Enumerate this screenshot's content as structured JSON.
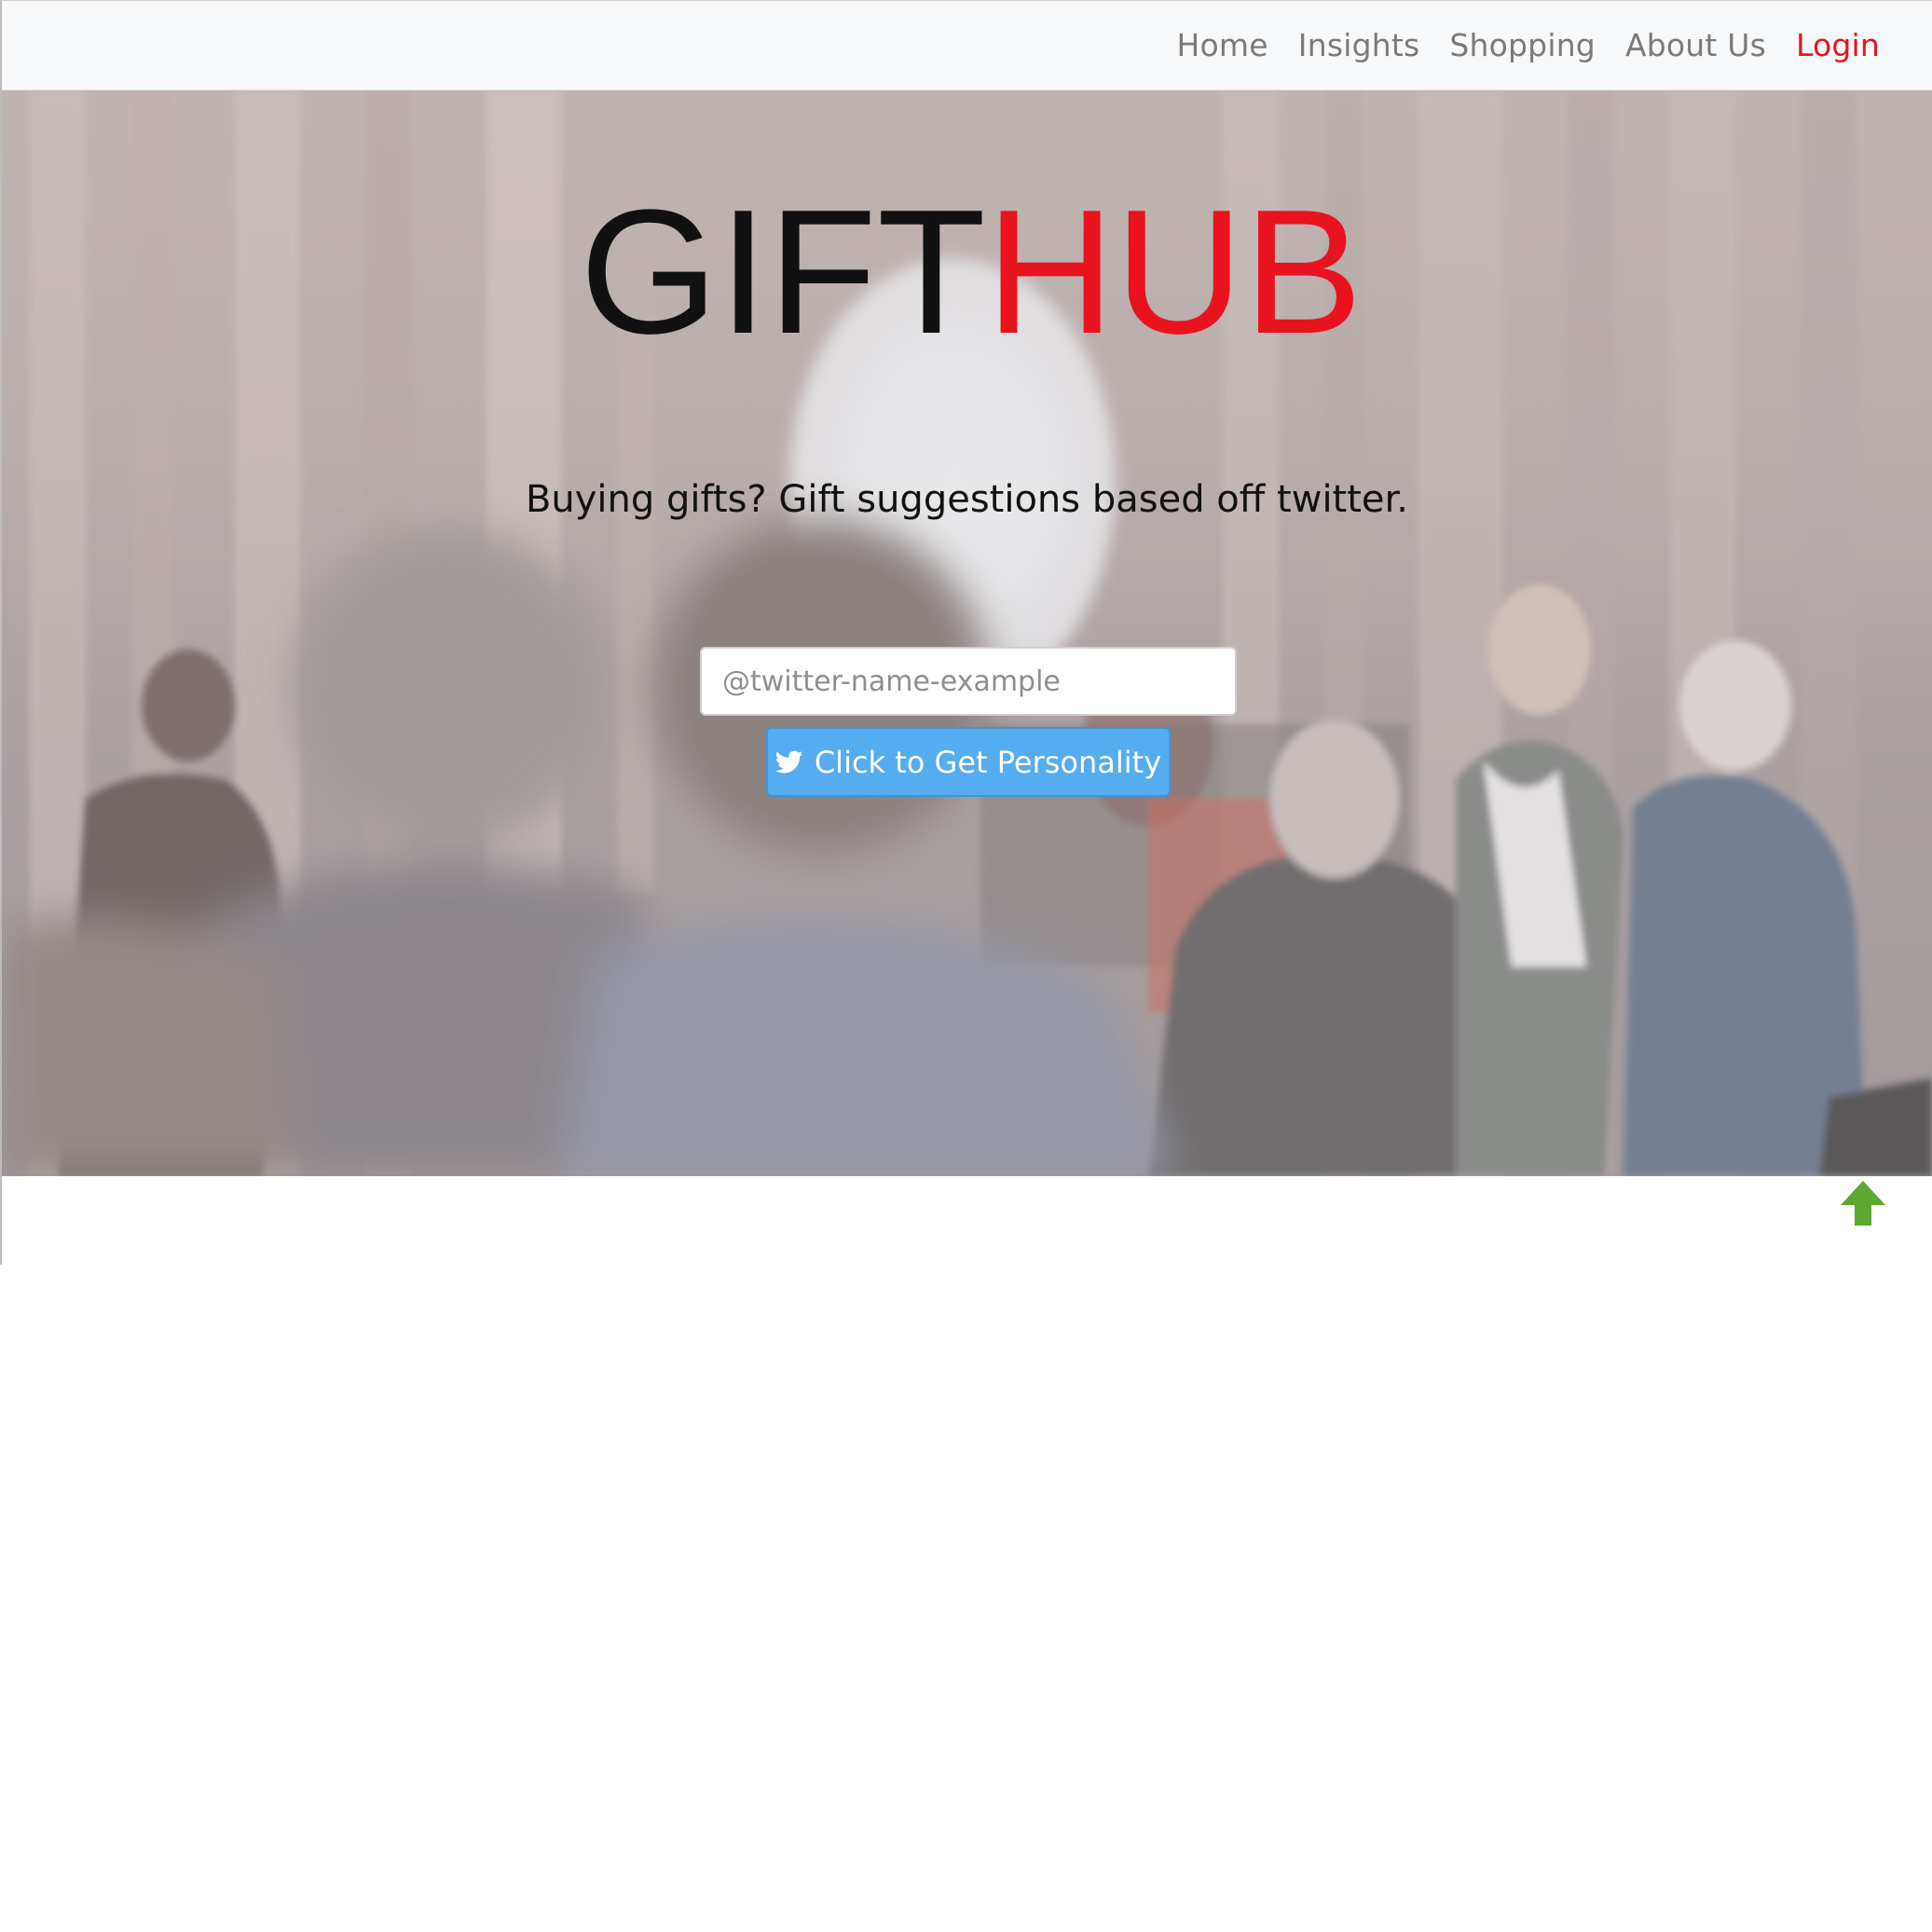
{
  "navbar": {
    "links": [
      {
        "label": "Home",
        "active": false
      },
      {
        "label": "Insights",
        "active": false
      },
      {
        "label": "Shopping",
        "active": false
      },
      {
        "label": "About Us",
        "active": false
      },
      {
        "label": "Login",
        "active": true
      }
    ]
  },
  "hero": {
    "logo": {
      "part1": "GIFT",
      "part2": "HUB"
    },
    "tagline": "Buying gifts? Gift suggestions based off twitter.",
    "search": {
      "placeholder": "@twitter-name-example",
      "value": ""
    },
    "cta_label": "Click to Get Personality"
  },
  "icons": {
    "cta_icon": "twitter-icon",
    "scroll_top": "arrow-up-icon"
  },
  "colors": {
    "accent_red": "#e8131f",
    "twitter_blue": "#55acee",
    "nav_text": "#7a7a7a",
    "scroll_arrow": "#5ca832"
  }
}
